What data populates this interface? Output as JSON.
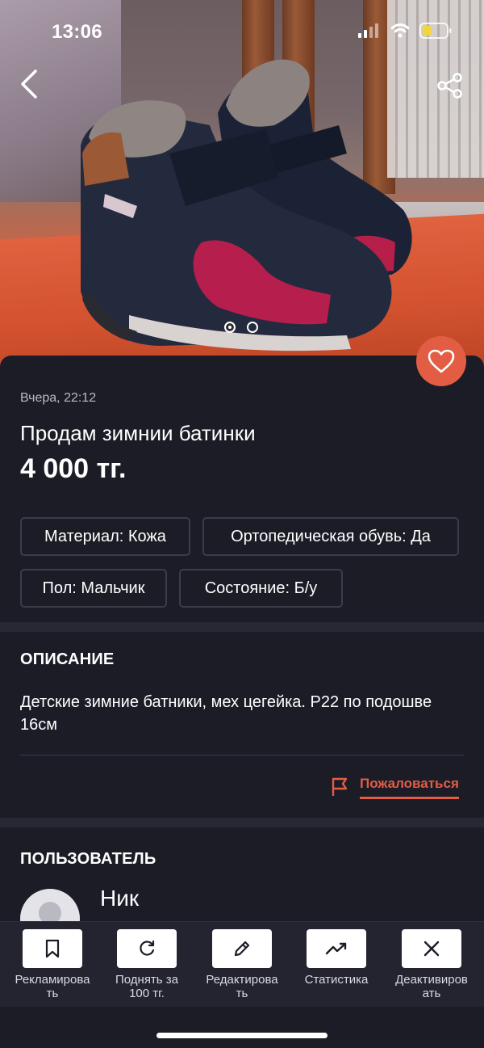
{
  "status_bar": {
    "time": "13:06"
  },
  "listing": {
    "date": "Вчера, 22:12",
    "title": "Продам зимнии батинки",
    "price": "4 000 тг."
  },
  "attributes": [
    "Материал: Кожа",
    "Ортопедическая обувь: Да",
    "Пол: Мальчик",
    "Состояние: Б/у"
  ],
  "description": {
    "heading": "ОПИСАНИЕ",
    "text": "Детские зимние батники, мех цегейка. Р22 по подошве 16см"
  },
  "report": {
    "label": "Пожаловаться",
    "icon": "flag-icon"
  },
  "user": {
    "heading": "ПОЛЬЗОВАТЕЛЬ",
    "name": "Ник"
  },
  "gallery": {
    "slides": 2,
    "active": 1
  },
  "actions": [
    {
      "label": "Рекламирова\nть",
      "icon": "bookmark-icon"
    },
    {
      "label": "Поднять за\n100 тг.",
      "icon": "refresh-icon"
    },
    {
      "label": "Редактирова\nть",
      "icon": "pencil-icon"
    },
    {
      "label": "Статистика",
      "icon": "trend-up-icon"
    },
    {
      "label": "Деактивиров\nать",
      "icon": "close-icon"
    }
  ],
  "colors": {
    "accent": "#e35d45",
    "background": "#1b1c26",
    "divider": "#272833"
  }
}
